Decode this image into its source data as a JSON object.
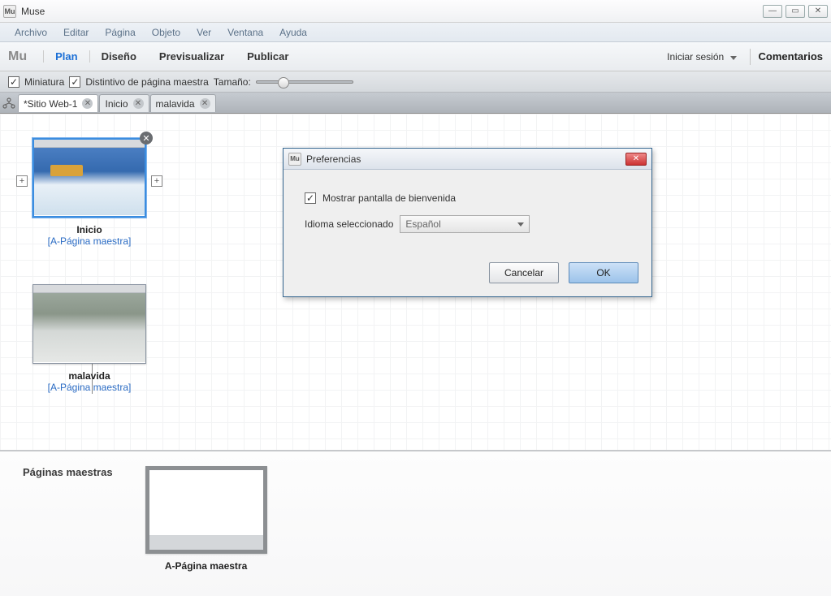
{
  "titlebar": {
    "app_name": "Muse",
    "app_tag": "Mu"
  },
  "menubar": [
    "Archivo",
    "Editar",
    "Página",
    "Objeto",
    "Ver",
    "Ventana",
    "Ayuda"
  ],
  "modebar": {
    "logo": "Mu",
    "modes": [
      {
        "label": "Plan",
        "active": true
      },
      {
        "label": "Diseño",
        "active": false
      },
      {
        "label": "Previsualizar",
        "active": false
      },
      {
        "label": "Publicar",
        "active": false
      }
    ],
    "login": "Iniciar sesión",
    "comments": "Comentarios"
  },
  "options": {
    "thumb_check": "Miniatura",
    "master_check": "Distintivo de página maestra",
    "size_label": "Tamaño:"
  },
  "tabs": {
    "site": "*Sitio Web-1",
    "items": [
      {
        "label": "Inicio"
      },
      {
        "label": "malavida"
      }
    ]
  },
  "pages": [
    {
      "name": "Inicio",
      "master": "[A-Página maestra]",
      "selected": true,
      "kind": "snow"
    },
    {
      "name": "malavida",
      "master": "[A-Página maestra]",
      "selected": false,
      "kind": "ice"
    }
  ],
  "masters": {
    "title": "Páginas maestras",
    "items": [
      {
        "name": "A-Página maestra"
      }
    ]
  },
  "dialog": {
    "title": "Preferencias",
    "welcome_check": "Mostrar pantalla de bienvenida",
    "lang_label": "Idioma seleccionado",
    "lang_value": "Español",
    "cancel": "Cancelar",
    "ok": "OK"
  }
}
